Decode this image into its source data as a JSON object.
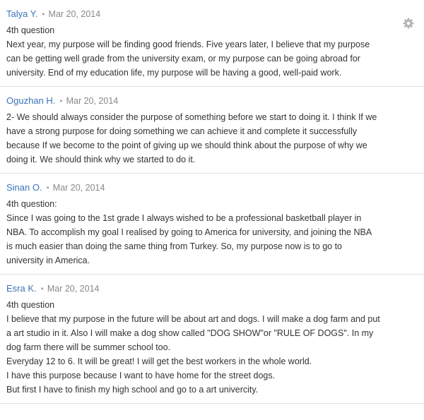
{
  "comments": [
    {
      "author": "Talya Y.",
      "separator": "•",
      "date": "Mar 20, 2014",
      "lines": [
        "4th question",
        "Next year, my purpose will be finding good friends. Five years later, I believe that my purpose",
        "can be getting well grade from the university exam, or my purpose can be going abroad for",
        "university. End of my education life, my purpose will be having a good, well-paid work."
      ]
    },
    {
      "author": "Oguzhan H.",
      "separator": "•",
      "date": "Mar 20, 2014",
      "lines": [
        "2- We should always consider the purpose of something before we start to doing it. I think If we",
        "have a strong purpose for doing something we can achieve it and complete it successfully",
        "because If we become to the point of giving up we should think about the purpose of why we",
        "doing it. We should think why we started to do it."
      ]
    },
    {
      "author": "Sinan O.",
      "separator": "•",
      "date": "Mar 20, 2014",
      "lines": [
        "4th question:",
        "Since I was going to the 1st grade I always wished to be a professional basketball player in",
        "NBA. To accomplish my goal I realised by going to America for university, and joining the NBA",
        "is much easier than doing the same thing from Turkey. So, my purpose now is to go to",
        "university in America."
      ]
    },
    {
      "author": "Esra K.",
      "separator": "•",
      "date": "Mar 20, 2014",
      "lines": [
        "4th question",
        "I believe that my purpose in the future will be about art and dogs. I will make a dog farm and put",
        "a art studio in it. Also I will make a dog show called \"DOG SHOW\"or \"RULE OF DOGS\". In my",
        "dog farm there will be summer school too.",
        "Everyday 12 to 6. It will be great! I will get the best workers in the whole world.",
        "I have this purpose because I want to have home for the street dogs.",
        "But first I have to finish my high school and go to a art univercity."
      ]
    }
  ],
  "icons": {
    "settings": "gear-icon"
  },
  "colors": {
    "author_link": "#3b73b9",
    "meta_text": "#888888",
    "body_text": "#333333",
    "divider": "#e3e3e3",
    "gear": "#b5b5b5"
  }
}
